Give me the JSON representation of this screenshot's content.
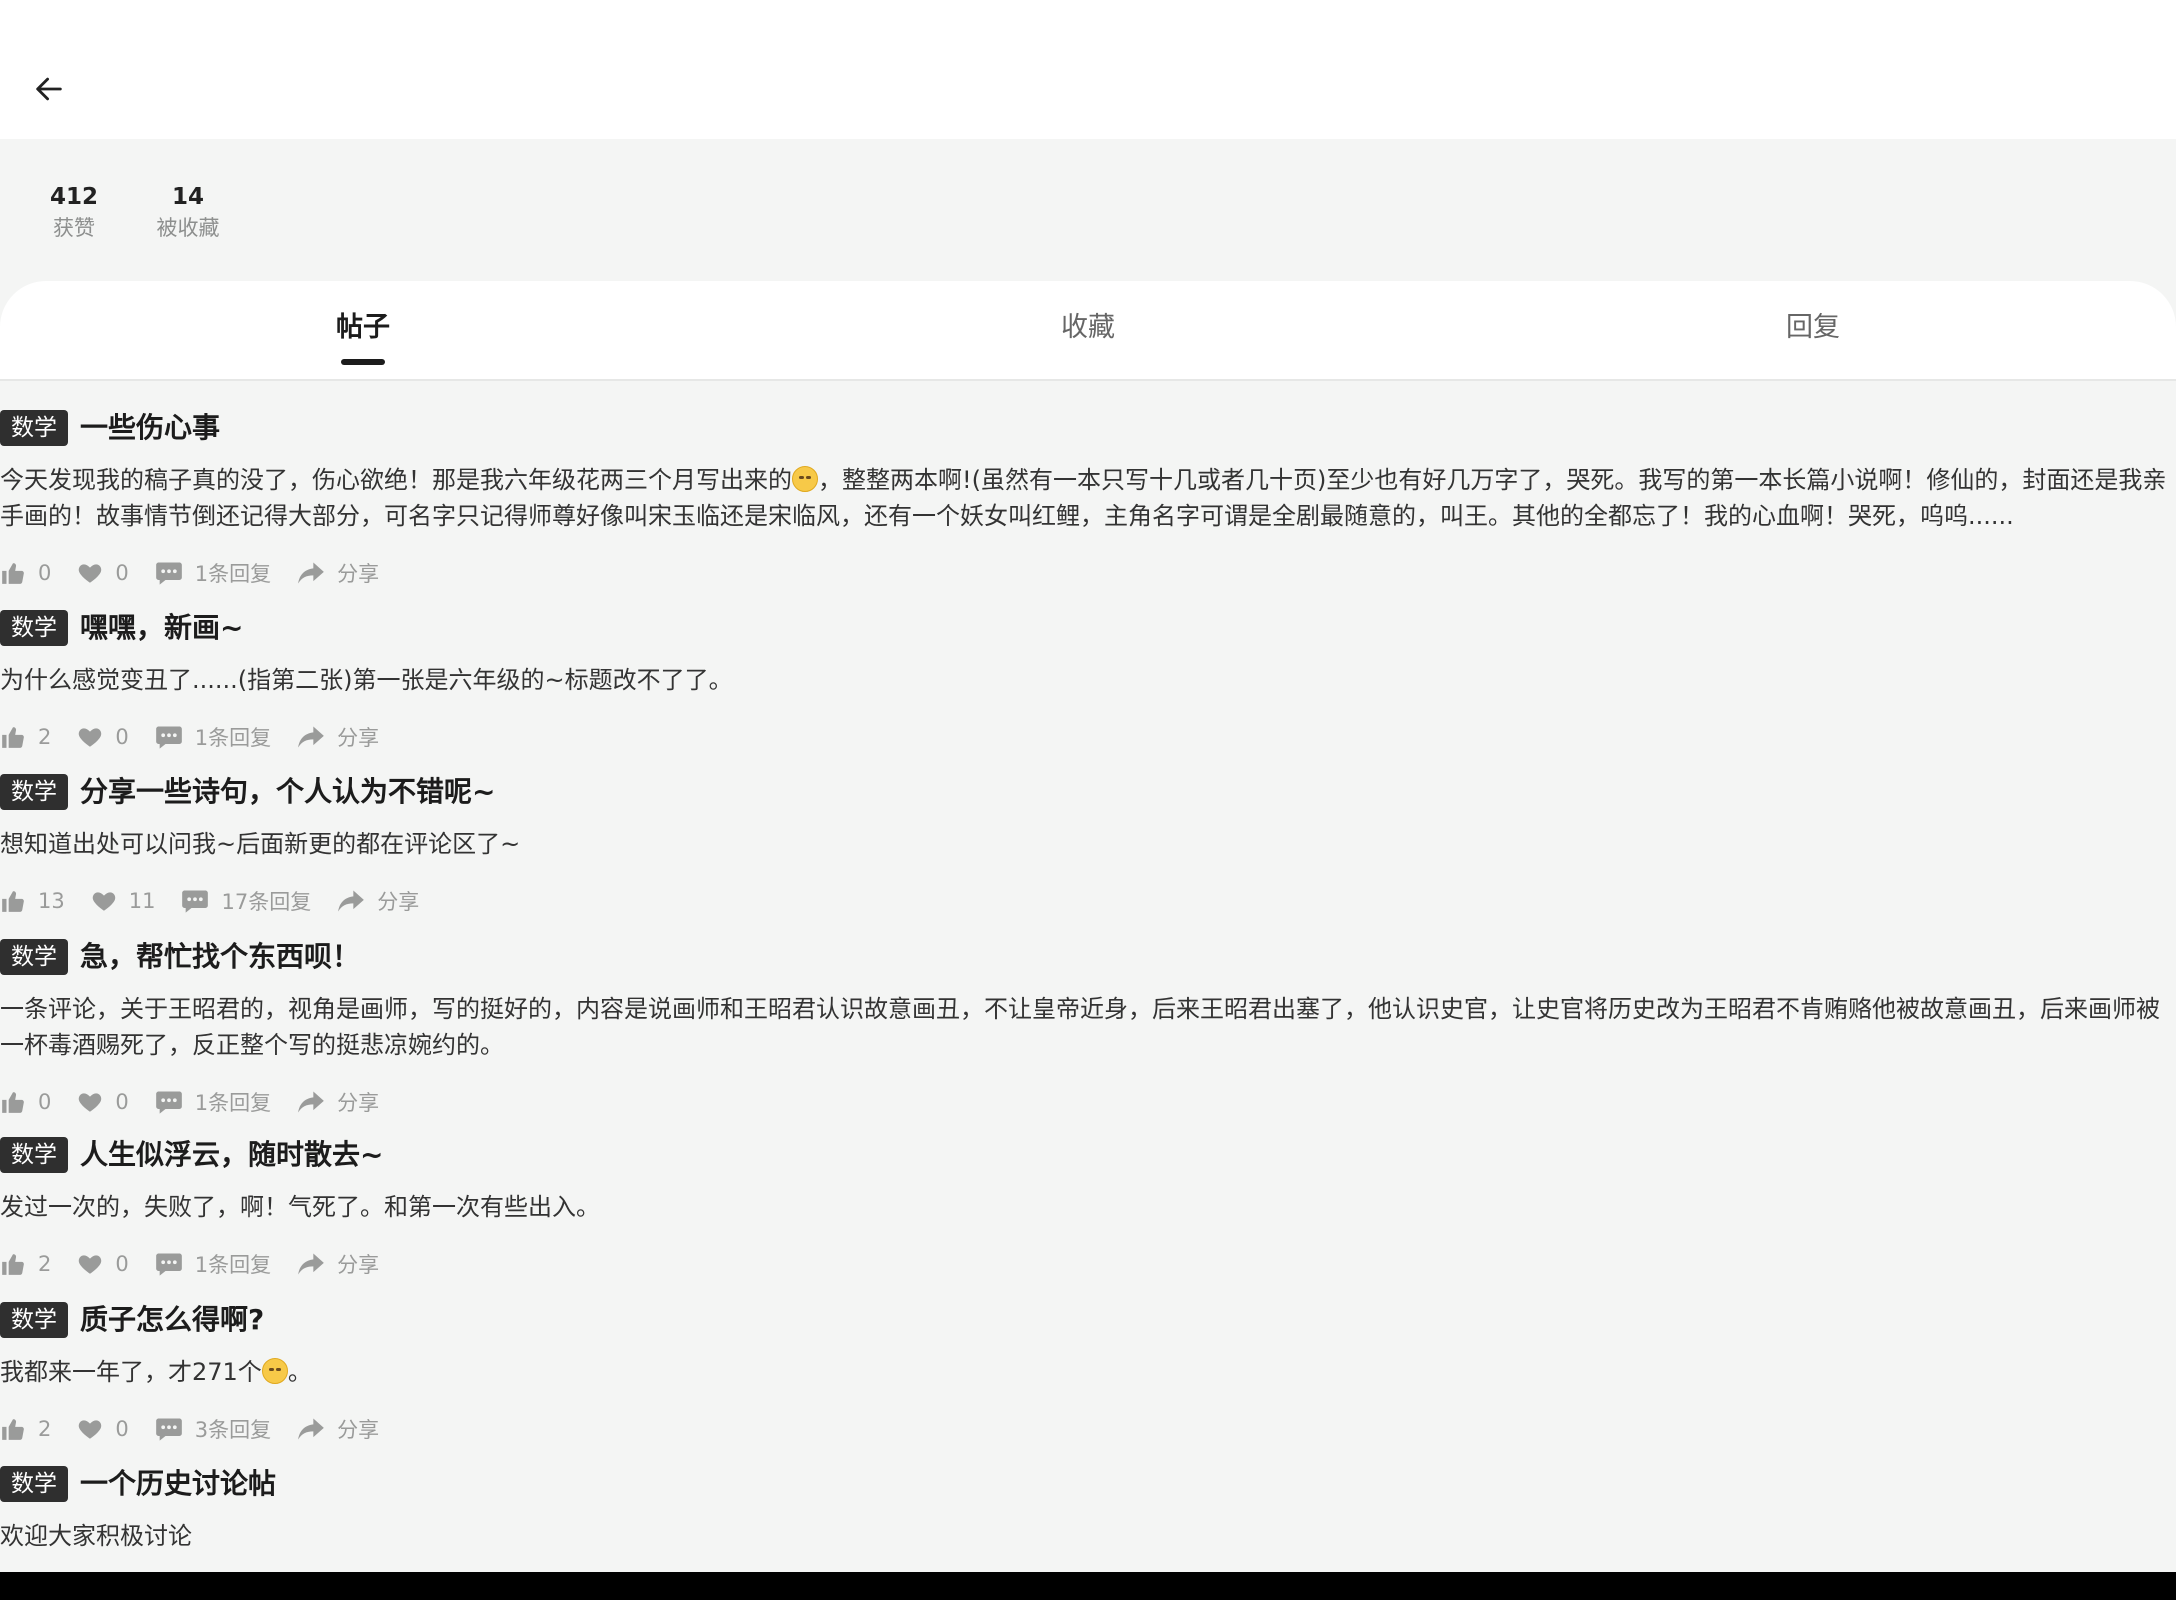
{
  "header": {
    "back_icon": "arrow-left-icon"
  },
  "stats": {
    "likes_count": "412",
    "likes_label": "获赞",
    "favorited_count": "14",
    "favorited_label": "被收藏"
  },
  "tabs": [
    {
      "label": "帖子",
      "active": true
    },
    {
      "label": "收藏",
      "active": false
    },
    {
      "label": "回复",
      "active": false
    }
  ],
  "posts": [
    {
      "tag": "数学",
      "title": "一些伤心事",
      "body_parts": [
        "今天发现我的稿子真的没了，伤心欲绝！那是我六年级花两三个月写出来的",
        "，整整两本啊!(虽然有一本只写十几或者几十页)至少也有好几万字了，哭死。我写的第一本长篇小说啊！修仙的，封面还是我亲手画的！故事情节倒还记得大部分，可名字只记得师尊好像叫宋玉临还是宋临风，还有一个妖女叫红鲤，主角名字可谓是全剧最随意的，叫王。其他的全都忘了！我的心血啊！哭死，呜呜......"
      ],
      "likes": "0",
      "favorites": "0",
      "replies": "1条回复",
      "share": "分享"
    },
    {
      "tag": "数学",
      "title": "嘿嘿，新画~",
      "body_parts": [
        "为什么感觉变丑了......(指第二张)第一张是六年级的~标题改不了了。"
      ],
      "likes": "2",
      "favorites": "0",
      "replies": "1条回复",
      "share": "分享"
    },
    {
      "tag": "数学",
      "title": "分享一些诗句，个人认为不错呢~",
      "body_parts": [
        "想知道出处可以问我~后面新更的都在评论区了~"
      ],
      "likes": "13",
      "favorites": "11",
      "replies": "17条回复",
      "share": "分享"
    },
    {
      "tag": "数学",
      "title": "急，帮忙找个东西呗！",
      "body_parts": [
        "一条评论，关于王昭君的，视角是画师，写的挺好的，内容是说画师和王昭君认识故意画丑，不让皇帝近身，后来王昭君出塞了，他认识史官，让史官将历史改为王昭君不肯贿赂他被故意画丑，后来画师被一杯毒酒赐死了，反正整个写的挺悲凉婉约的。"
      ],
      "likes": "0",
      "favorites": "0",
      "replies": "1条回复",
      "share": "分享"
    },
    {
      "tag": "数学",
      "title": "人生似浮云，随时散去~",
      "body_parts": [
        "发过一次的，失败了，啊！气死了。和第一次有些出入。"
      ],
      "likes": "2",
      "favorites": "0",
      "replies": "1条回复",
      "share": "分享"
    },
    {
      "tag": "数学",
      "title": "质子怎么得啊?",
      "body_parts": [
        "我都来一年了，才271个",
        "。"
      ],
      "likes": "2",
      "favorites": "0",
      "replies": "3条回复",
      "share": "分享"
    },
    {
      "tag": "数学",
      "title": "一个历史讨论帖",
      "body_parts": [
        "欢迎大家积极讨论"
      ]
    }
  ]
}
